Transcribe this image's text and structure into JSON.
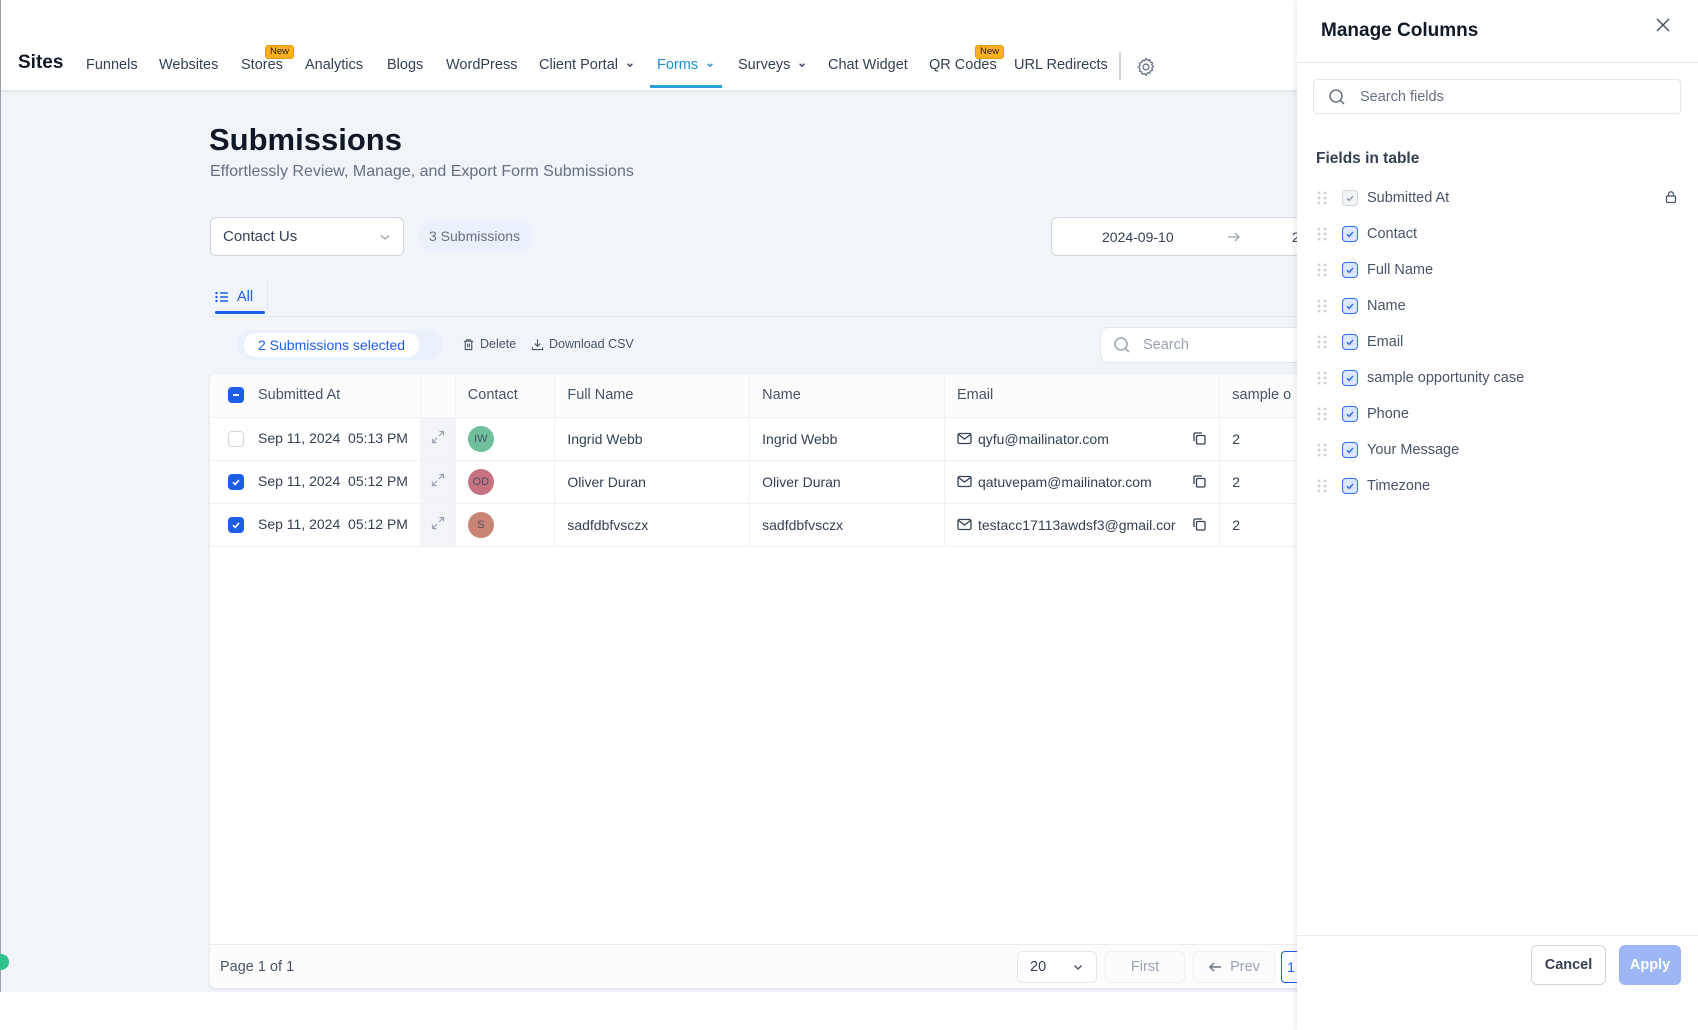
{
  "nav": {
    "brand": "Sites",
    "items": [
      {
        "label": "Funnels"
      },
      {
        "label": "Websites"
      },
      {
        "label": "Stores",
        "badge": "New"
      },
      {
        "label": "Analytics"
      },
      {
        "label": "Blogs"
      },
      {
        "label": "WordPress"
      },
      {
        "label": "Client Portal",
        "dropdown": true
      },
      {
        "label": "Forms",
        "dropdown": true,
        "active": true
      },
      {
        "label": "Surveys",
        "dropdown": true
      },
      {
        "label": "Chat Widget"
      },
      {
        "label": "QR Codes",
        "badge": "New"
      },
      {
        "label": "URL Redirects"
      }
    ],
    "settings_icon": "gear-icon"
  },
  "page": {
    "title": "Submissions",
    "subtitle": "Effortlessly Review, Manage, and Export Form Submissions",
    "form_select": "Contact Us",
    "submission_count": "3 Submissions",
    "date_start": "2024-09-10",
    "date_end": "2",
    "tab_all": "All"
  },
  "toolbar": {
    "selected_label": "2 Submissions selected",
    "delete_label": "Delete",
    "download_label": "Download CSV",
    "search_placeholder": "Search"
  },
  "table": {
    "columns": [
      "Submitted At",
      "Contact",
      "Full Name",
      "Name",
      "Email",
      "sample o"
    ],
    "rows": [
      {
        "checked": false,
        "submitted_at": "Sep 11, 2024  05:13 PM",
        "initials": "IW",
        "avatar_color": "#6fbf9c",
        "full_name": "Ingrid Webb",
        "name": "Ingrid Webb",
        "email": "qyfu@mailinator.com",
        "sample": "2"
      },
      {
        "checked": true,
        "submitted_at": "Sep 11, 2024  05:12 PM",
        "initials": "OD",
        "avatar_color": "#c77280",
        "full_name": "Oliver Duran",
        "name": "Oliver Duran",
        "email": "qatuvepam@mailinator.com",
        "sample": "2"
      },
      {
        "checked": true,
        "submitted_at": "Sep 11, 2024  05:12 PM",
        "initials": "S",
        "avatar_color": "#c98474",
        "full_name": "sadfdbfvsczx",
        "name": "sadfdbfvsczx",
        "email": "testacc17113awdsf3@gmail.cor",
        "sample": "2"
      }
    ]
  },
  "pagination": {
    "page_text": "Page 1 of 1",
    "page_size": "20",
    "first_label": "First",
    "prev_label": "Prev",
    "current_page": "1"
  },
  "panel": {
    "title": "Manage Columns",
    "search_placeholder": "Search fields",
    "heading": "Fields in table",
    "fields": [
      {
        "label": "Submitted At",
        "checked": true,
        "locked": true
      },
      {
        "label": "Contact",
        "checked": true
      },
      {
        "label": "Full Name",
        "checked": true
      },
      {
        "label": "Name",
        "checked": true
      },
      {
        "label": "Email",
        "checked": true
      },
      {
        "label": "sample opportunity case",
        "checked": true
      },
      {
        "label": "Phone",
        "checked": true
      },
      {
        "label": "Your Message",
        "checked": true
      },
      {
        "label": "Timezone",
        "checked": true
      }
    ],
    "cancel_label": "Cancel",
    "apply_label": "Apply"
  },
  "colors": {
    "accent": "#1d5ee8",
    "nav_active": "#1e8fd5",
    "badge": "#fdb022",
    "apply_disabled": "#9db7f5"
  }
}
